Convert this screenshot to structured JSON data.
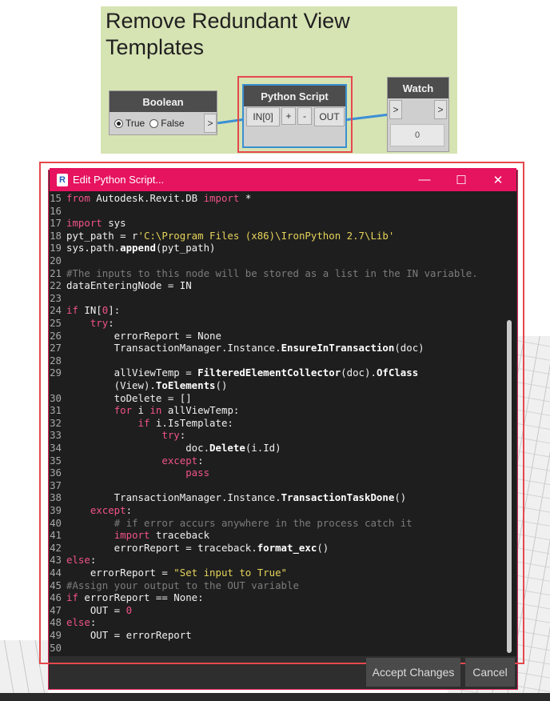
{
  "group": {
    "title": "Remove Redundant View Templates"
  },
  "boolean_node": {
    "title": "Boolean",
    "option_true": "True",
    "option_false": "False",
    "selected": "True",
    "out_port": ">"
  },
  "python_node": {
    "title": "Python Script",
    "in_port": "IN[0]",
    "add": "+",
    "remove": "-",
    "out_port": "OUT"
  },
  "watch_node": {
    "title": "Watch",
    "in_port": ">",
    "out_port": ">",
    "value": "0"
  },
  "editor_window": {
    "title": "Edit Python Script...",
    "minimize": "—",
    "maximize": "☐",
    "close": "✕",
    "accept_label": "Accept Changes",
    "cancel_label": "Cancel"
  },
  "colors": {
    "accent": "#e6135e",
    "group_bg": "#d6e3b3",
    "wire": "#3c8fd5",
    "highlight": "#e5484d"
  },
  "code_lines": [
    {
      "n": "15",
      "tokens": [
        [
          "k",
          "from"
        ],
        [
          "d",
          " Autodesk.Revit.DB "
        ],
        [
          "k",
          "import"
        ],
        [
          "d",
          " *"
        ]
      ]
    },
    {
      "n": "16",
      "tokens": []
    },
    {
      "n": "17",
      "tokens": [
        [
          "k",
          "import"
        ],
        [
          "d",
          " sys"
        ]
      ]
    },
    {
      "n": "18",
      "tokens": [
        [
          "d",
          "pyt_path = r"
        ],
        [
          "s",
          "'C:\\Program Files (x86)\\IronPython 2.7\\Lib'"
        ]
      ]
    },
    {
      "n": "19",
      "tokens": [
        [
          "d",
          "sys.path."
        ],
        [
          "f",
          "append"
        ],
        [
          "d",
          "(pyt_path)"
        ]
      ]
    },
    {
      "n": "20",
      "tokens": []
    },
    {
      "n": "21",
      "tokens": [
        [
          "c",
          "#The inputs to this node will be stored as a list in the IN variable."
        ]
      ]
    },
    {
      "n": "22",
      "tokens": [
        [
          "d",
          "dataEnteringNode = IN"
        ]
      ]
    },
    {
      "n": "23",
      "tokens": []
    },
    {
      "n": "24",
      "tokens": [
        [
          "k",
          "if"
        ],
        [
          "d",
          " IN["
        ],
        [
          "n",
          "0"
        ],
        [
          "d",
          "]:"
        ]
      ]
    },
    {
      "n": "25",
      "tokens": [
        [
          "d",
          "    "
        ],
        [
          "k",
          "try"
        ],
        [
          "d",
          ":"
        ]
      ]
    },
    {
      "n": "26",
      "tokens": [
        [
          "d",
          "        errorReport = None"
        ]
      ]
    },
    {
      "n": "27",
      "tokens": [
        [
          "d",
          "        TransactionManager.Instance."
        ],
        [
          "f",
          "EnsureInTransaction"
        ],
        [
          "d",
          "(doc)"
        ]
      ]
    },
    {
      "n": "28",
      "tokens": []
    },
    {
      "n": "29",
      "tokens": [
        [
          "d",
          "        allViewTemp = "
        ],
        [
          "f",
          "FilteredElementCollector"
        ],
        [
          "d",
          "(doc)."
        ],
        [
          "f",
          "OfClass"
        ]
      ]
    },
    {
      "n": "",
      "tokens": [
        [
          "d",
          "        (View)."
        ],
        [
          "f",
          "ToElements"
        ],
        [
          "d",
          "()"
        ]
      ]
    },
    {
      "n": "30",
      "tokens": [
        [
          "d",
          "        toDelete = []"
        ]
      ]
    },
    {
      "n": "31",
      "tokens": [
        [
          "d",
          "        "
        ],
        [
          "k",
          "for"
        ],
        [
          "d",
          " i "
        ],
        [
          "k",
          "in"
        ],
        [
          "d",
          " allViewTemp:"
        ]
      ]
    },
    {
      "n": "32",
      "tokens": [
        [
          "d",
          "            "
        ],
        [
          "k",
          "if"
        ],
        [
          "d",
          " i.IsTemplate:"
        ]
      ]
    },
    {
      "n": "33",
      "tokens": [
        [
          "d",
          "                "
        ],
        [
          "k",
          "try"
        ],
        [
          "d",
          ":"
        ]
      ]
    },
    {
      "n": "34",
      "tokens": [
        [
          "d",
          "                    doc."
        ],
        [
          "f",
          "Delete"
        ],
        [
          "d",
          "(i.Id)"
        ]
      ]
    },
    {
      "n": "35",
      "tokens": [
        [
          "d",
          "                "
        ],
        [
          "k",
          "except"
        ],
        [
          "d",
          ":"
        ]
      ]
    },
    {
      "n": "36",
      "tokens": [
        [
          "d",
          "                    "
        ],
        [
          "k",
          "pass"
        ]
      ]
    },
    {
      "n": "37",
      "tokens": []
    },
    {
      "n": "38",
      "tokens": [
        [
          "d",
          "        TransactionManager.Instance."
        ],
        [
          "f",
          "TransactionTaskDone"
        ],
        [
          "d",
          "()"
        ]
      ]
    },
    {
      "n": "39",
      "tokens": [
        [
          "d",
          "    "
        ],
        [
          "k",
          "except"
        ],
        [
          "d",
          ":"
        ]
      ]
    },
    {
      "n": "40",
      "tokens": [
        [
          "d",
          "        "
        ],
        [
          "c",
          "# if error accurs anywhere in the process catch it"
        ]
      ]
    },
    {
      "n": "41",
      "tokens": [
        [
          "d",
          "        "
        ],
        [
          "k",
          "import"
        ],
        [
          "d",
          " traceback"
        ]
      ]
    },
    {
      "n": "42",
      "tokens": [
        [
          "d",
          "        errorReport = traceback."
        ],
        [
          "f",
          "format_exc"
        ],
        [
          "d",
          "()"
        ]
      ]
    },
    {
      "n": "43",
      "tokens": [
        [
          "k",
          "else"
        ],
        [
          "d",
          ":"
        ]
      ]
    },
    {
      "n": "44",
      "tokens": [
        [
          "d",
          "    errorReport = "
        ],
        [
          "s",
          "\"Set input to True\""
        ]
      ]
    },
    {
      "n": "45",
      "tokens": [
        [
          "c",
          "#Assign your output to the OUT variable"
        ]
      ]
    },
    {
      "n": "46",
      "tokens": [
        [
          "k",
          "if"
        ],
        [
          "d",
          " errorReport == None:"
        ]
      ]
    },
    {
      "n": "47",
      "tokens": [
        [
          "d",
          "    OUT = "
        ],
        [
          "n",
          "0"
        ]
      ]
    },
    {
      "n": "48",
      "tokens": [
        [
          "k",
          "else"
        ],
        [
          "d",
          ":"
        ]
      ]
    },
    {
      "n": "49",
      "tokens": [
        [
          "d",
          "    OUT = errorReport"
        ]
      ]
    },
    {
      "n": "50",
      "tokens": []
    }
  ]
}
